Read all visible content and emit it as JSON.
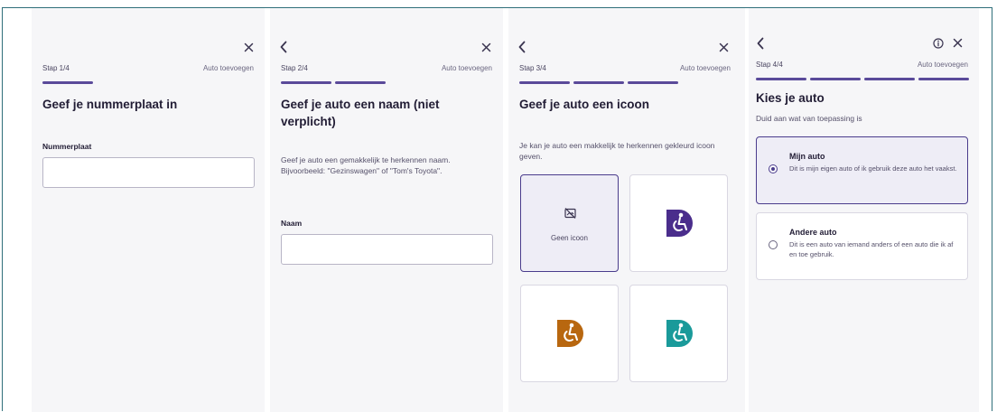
{
  "colors": {
    "accent": "#5a4a9a",
    "frame_border": "#2f6f7a",
    "icon_purple": "#4a2d8c",
    "icon_orange": "#b8670f",
    "icon_teal": "#1a9a9a"
  },
  "screen1": {
    "step": "Stap 1/4",
    "add_label": "Auto toevoegen",
    "title": "Geef je nummerplaat in",
    "field_label": "Nummerplaat",
    "field_value": ""
  },
  "screen2": {
    "step": "Stap 2/4",
    "add_label": "Auto toevoegen",
    "title": "Geef je auto een naam (niet verplicht)",
    "description": "Geef je auto een gemakkelijk te herkennen naam. Bijvoorbeeld: \"Gezinswagen\" of \"Tom's Toyota\".",
    "field_label": "Naam",
    "field_value": ""
  },
  "screen3": {
    "step": "Stap 3/4",
    "add_label": "Auto toevoegen",
    "title": "Geef je auto een icoon",
    "description": "Je kan je auto een makkelijk te herkennen gekleurd icoon geven.",
    "no_icon_label": "Geen icoon",
    "selected": "Geen icoon",
    "icons": [
      "no-icon",
      "wheelchair-purple-icon",
      "wheelchair-orange-icon",
      "wheelchair-teal-icon"
    ]
  },
  "screen4": {
    "step": "Stap 4/4",
    "add_label": "Auto toevoegen",
    "title": "Kies je auto",
    "subtitle": "Duid aan wat van toepassing is",
    "options": [
      {
        "title": "Mijn auto",
        "description": "Dit is mijn eigen auto of ik gebruik deze auto het vaakst.",
        "selected": true
      },
      {
        "title": "Andere auto",
        "description": "Dit is een auto van iemand anders of een auto die ik af en toe gebruik.",
        "selected": false
      }
    ]
  }
}
